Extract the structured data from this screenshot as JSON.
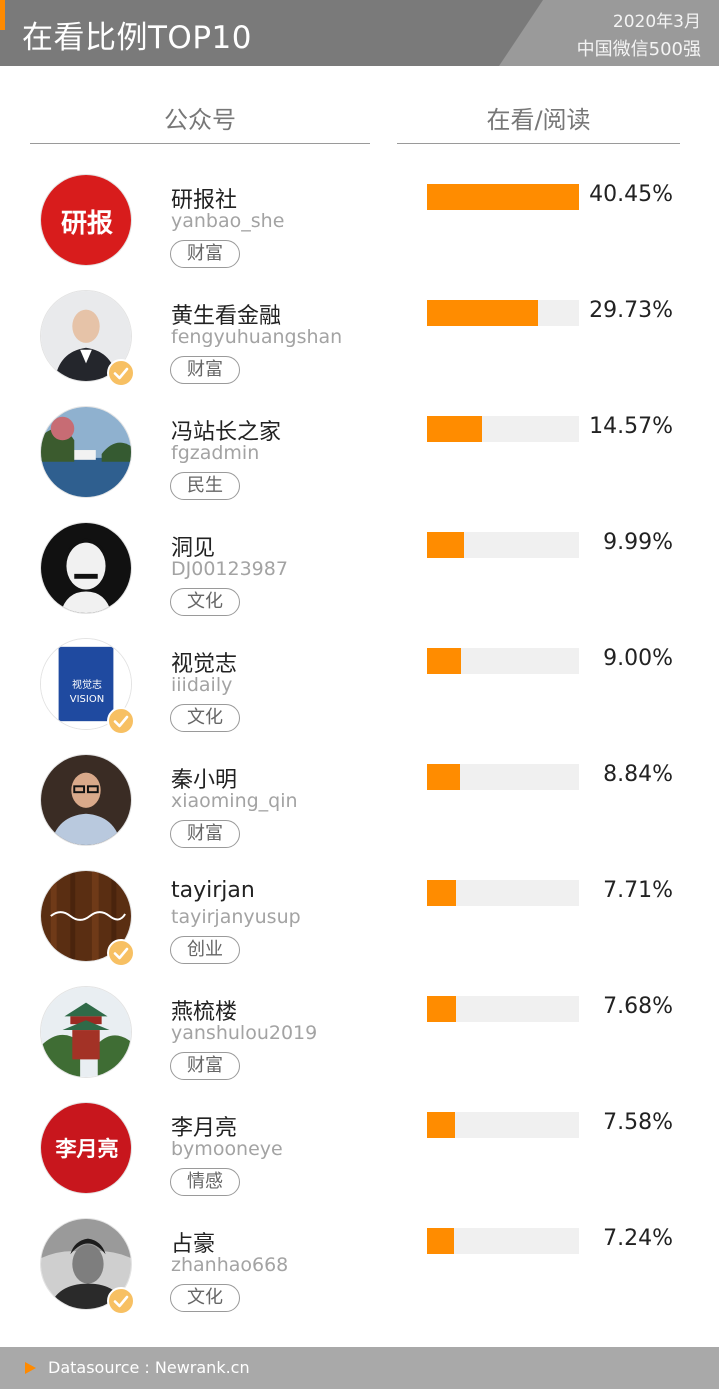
{
  "header": {
    "title": "在看比例TOP10",
    "date": "2020年3月",
    "subtitle": "中国微信500强"
  },
  "columns": {
    "account": "公众号",
    "ratio": "在看/阅读"
  },
  "colors": {
    "bar": "#ff8c00",
    "track": "#f0f0f0",
    "header": "#7a7a7a",
    "verified": "#f7c063"
  },
  "rows": [
    {
      "name": "研报社",
      "account": "yanbao_she",
      "tag": "财富",
      "pct": "40.45%",
      "ratio": 0.4045,
      "verified": false,
      "avatar_text": "研报"
    },
    {
      "name": "黄生看金融",
      "account": "fengyuhuangshan",
      "tag": "财富",
      "pct": "29.73%",
      "ratio": 0.2973,
      "verified": true,
      "avatar_text": ""
    },
    {
      "name": "冯站长之家",
      "account": "fgzadmin",
      "tag": "民生",
      "pct": "14.57%",
      "ratio": 0.1457,
      "verified": false,
      "avatar_text": ""
    },
    {
      "name": "洞见",
      "account": "DJ00123987",
      "tag": "文化",
      "pct": "9.99%",
      "ratio": 0.0999,
      "verified": false,
      "avatar_text": ""
    },
    {
      "name": "视觉志",
      "account": "iiidaily",
      "tag": "文化",
      "pct": "9.00%",
      "ratio": 0.09,
      "verified": true,
      "avatar_text": "视觉志 VISION"
    },
    {
      "name": "秦小明",
      "account": "xiaoming_qin",
      "tag": "财富",
      "pct": "8.84%",
      "ratio": 0.0884,
      "verified": false,
      "avatar_text": ""
    },
    {
      "name": "tayirjan",
      "account": "tayirjanyusup",
      "tag": "创业",
      "pct": "7.71%",
      "ratio": 0.0771,
      "verified": true,
      "avatar_text": ""
    },
    {
      "name": "燕梳楼",
      "account": "yanshulou2019",
      "tag": "财富",
      "pct": "7.68%",
      "ratio": 0.0768,
      "verified": false,
      "avatar_text": ""
    },
    {
      "name": "李月亮",
      "account": "bymooneye",
      "tag": "情感",
      "pct": "7.58%",
      "ratio": 0.0758,
      "verified": false,
      "avatar_text": "李月亮"
    },
    {
      "name": "占豪",
      "account": "zhanhao668",
      "tag": "文化",
      "pct": "7.24%",
      "ratio": 0.0724,
      "verified": true,
      "avatar_text": ""
    }
  ],
  "footer": {
    "source": "Datasource : Newrank.cn"
  }
}
